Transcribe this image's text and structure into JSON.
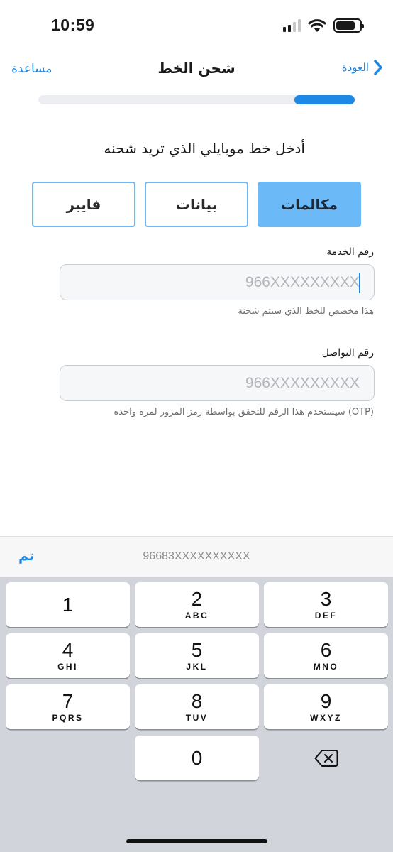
{
  "status_bar": {
    "time": "10:59"
  },
  "nav": {
    "help_label": "مساعدة",
    "title": "شحن الخط",
    "back_label": "العودة"
  },
  "progress": {
    "fraction": 0.19
  },
  "prompt": "أدخل خط موبايلي الذي تريد شحنه",
  "tabs": [
    {
      "label": "مكالمات",
      "active": true
    },
    {
      "label": "بيانات",
      "active": false
    },
    {
      "label": "فايبر",
      "active": false
    }
  ],
  "service_field": {
    "label": "رقم الخدمة",
    "placeholder": "966XXXXXXXXX",
    "value": "",
    "hint": "هذا مخصص للخط الذي سيتم شحنة"
  },
  "contact_field": {
    "label": "رقم التواصل",
    "placeholder": "966XXXXXXXXX",
    "value": "",
    "hint": "سيستخدم هذا الرقم للتحقق بواسطة رمز المرور لمرة واحدة (OTP)"
  },
  "keyboard": {
    "done_label": "تم",
    "suggestion": "96683XXXXXXXXXX",
    "keys": [
      {
        "digit": "1",
        "letters": ""
      },
      {
        "digit": "2",
        "letters": "ABC"
      },
      {
        "digit": "3",
        "letters": "DEF"
      },
      {
        "digit": "4",
        "letters": "GHI"
      },
      {
        "digit": "5",
        "letters": "JKL"
      },
      {
        "digit": "6",
        "letters": "MNO"
      },
      {
        "digit": "7",
        "letters": "PQRS"
      },
      {
        "digit": "8",
        "letters": "TUV"
      },
      {
        "digit": "9",
        "letters": "WXYZ"
      },
      {
        "digit": "0",
        "letters": ""
      }
    ]
  },
  "colors": {
    "accent": "#1e88e5",
    "active_tab": "#6cb9f7",
    "keyboard_bg": "#d1d4da"
  }
}
